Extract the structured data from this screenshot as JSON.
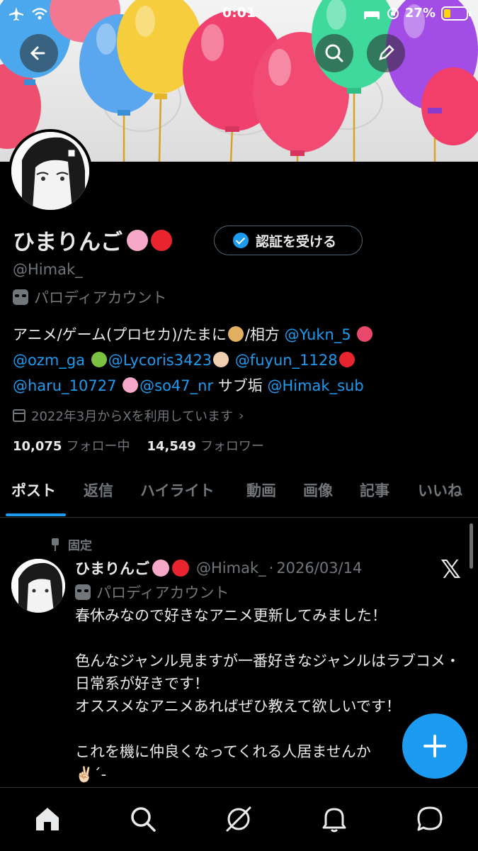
{
  "status_bar": {
    "time": "0:01",
    "battery_percent": "27%"
  },
  "profile": {
    "display_name": "ひまりんご",
    "verify_button_label": "認証を受ける",
    "handle": "@Himak_",
    "parody_label": "パロディアカウント",
    "bio": {
      "line1_text": "アニメ/ゲーム(プロセカ)/たまに",
      "line1_mid": "/相方 ",
      "line1_link": "@Yukn_5",
      "line2_link1": "@ozm_ga",
      "line2_link2": "@Lycoris3423",
      "line2_link3": "@fuyun_1128",
      "line3_link1": "@haru_10727",
      "line3_link2": "@so47_nr",
      "line3_text": " サブ垢 ",
      "line3_link3": "@Himak_sub"
    },
    "joined": "2022年3月からXを利用しています",
    "following_count": "10,075",
    "following_label": "フォロー中",
    "followers_count": "14,549",
    "followers_label": "フォロワー"
  },
  "tabs": [
    "ポスト",
    "返信",
    "ハイライト",
    "動画",
    "画像",
    "記事",
    "いいね"
  ],
  "post": {
    "pinned_label": "固定",
    "author_name": "ひまりんご",
    "author_handle": "@Himak_",
    "date": "2026/03/14",
    "parody_label": "パロディアカウント",
    "text": "春休みなので好きなアニメ更新してみました！\n\n色んなジャンル見ますが一番好きなジャンルはラブコメ・日常系が好きです！\nオススメなアニメあればぜひ教えて欲しいです！\n\nこれを機に仲良くなってくれる人居ませんか\n✌🏻´-",
    "x_logo": "𝕏"
  },
  "icons": {
    "nav": [
      "home-icon",
      "search-icon",
      "grok-icon",
      "notifications-icon",
      "messages-icon"
    ],
    "fab": "compose-plus-icon"
  },
  "colors": {
    "accent": "#1d9bf0",
    "text_primary": "#e7e9ea",
    "text_secondary": "#71767b",
    "background": "#000000"
  }
}
